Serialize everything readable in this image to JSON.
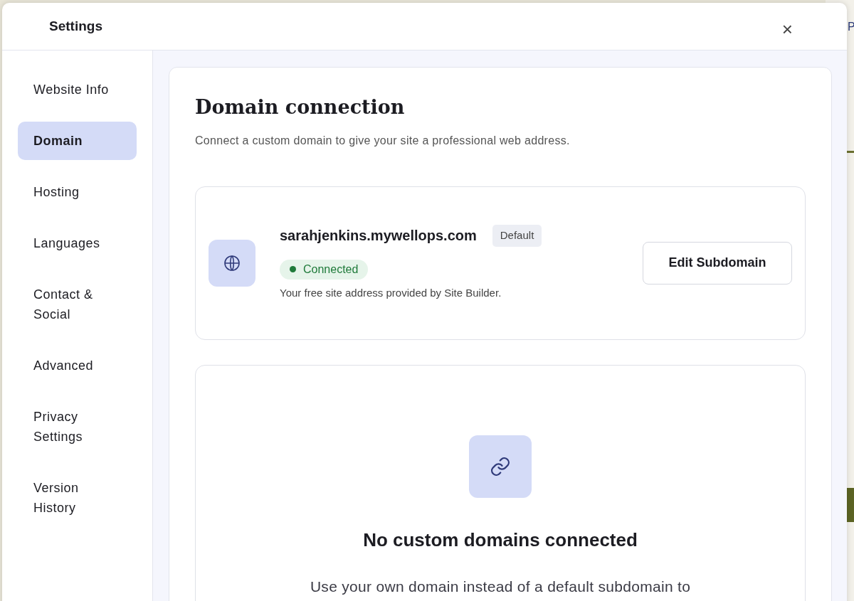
{
  "background_page": {
    "fragment": "P"
  },
  "window": {
    "title": "Settings",
    "close": "×"
  },
  "sidebar": {
    "items": [
      {
        "label": "Website Info",
        "selected": false
      },
      {
        "label": "Domain",
        "selected": true
      },
      {
        "label": "Hosting",
        "selected": false
      },
      {
        "label": "Languages",
        "selected": false
      },
      {
        "label": "Contact &\nSocial",
        "selected": false
      },
      {
        "label": "Advanced",
        "selected": false
      },
      {
        "label": "Privacy\nSettings",
        "selected": false
      },
      {
        "label": "Version\nHistory",
        "selected": false
      }
    ]
  },
  "panel": {
    "title": "Domain connection",
    "subtitle": "Connect a custom domain to give your site a professional web address.",
    "subdomain": {
      "address": "sarahjenkins.mywellops.com",
      "badge": "Default",
      "status": {
        "label": "Connected",
        "connected": true
      },
      "note": "Your free site address provided by Site Builder.",
      "button": "Edit Subdomain"
    },
    "empty_state": {
      "title": "No custom domains connected",
      "text": "Use your own domain instead of a default subdomain to"
    }
  }
}
